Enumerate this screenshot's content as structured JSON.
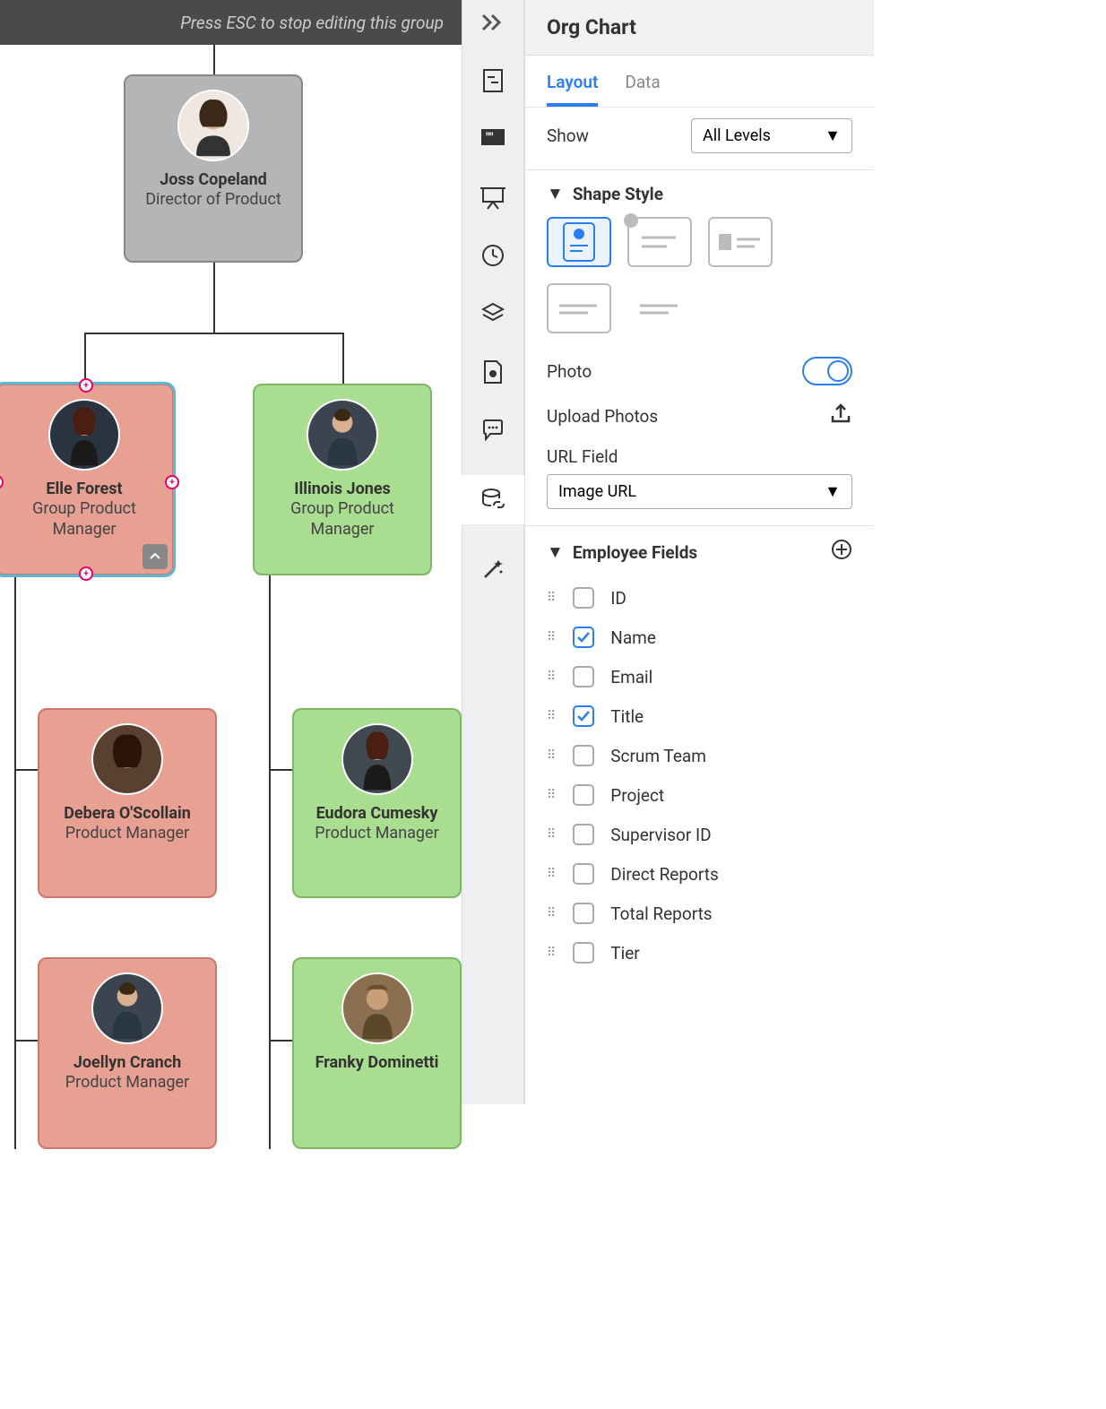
{
  "top_bar": {
    "message": "Press ESC to stop editing this group"
  },
  "org": {
    "root": {
      "name": "Joss Copeland",
      "title": "Director of Product"
    },
    "left_mgr": {
      "name": "Elle Forest",
      "title": "Group Product Manager"
    },
    "right_mgr": {
      "name": "Illinois Jones",
      "title": "Group Product Manager"
    },
    "left_r1": {
      "name": "Debera O'Scollain",
      "title": "Product Manager"
    },
    "right_r1": {
      "name": "Eudora Cumesky",
      "title": "Product Manager"
    },
    "left_r2": {
      "name": "Joellyn Cranch",
      "title": "Product Manager"
    },
    "right_r2": {
      "name": "Franky Dominetti"
    }
  },
  "panel": {
    "title": "Org Chart",
    "tabs": {
      "layout": "Layout",
      "data": "Data"
    },
    "show": {
      "label": "Show",
      "value": "All Levels"
    },
    "shape_style": "Shape Style",
    "photo": "Photo",
    "upload": "Upload Photos",
    "url_field": {
      "label": "URL Field",
      "value": "Image URL"
    },
    "employee_fields": "Employee Fields",
    "fields": [
      {
        "label": "ID",
        "checked": false
      },
      {
        "label": "Name",
        "checked": true
      },
      {
        "label": "Email",
        "checked": false
      },
      {
        "label": "Title",
        "checked": true
      },
      {
        "label": "Scrum Team",
        "checked": false
      },
      {
        "label": "Project",
        "checked": false
      },
      {
        "label": "Supervisor ID",
        "checked": false
      },
      {
        "label": "Direct Reports",
        "checked": false
      },
      {
        "label": "Total Reports",
        "checked": false
      },
      {
        "label": "Tier",
        "checked": false
      }
    ]
  }
}
